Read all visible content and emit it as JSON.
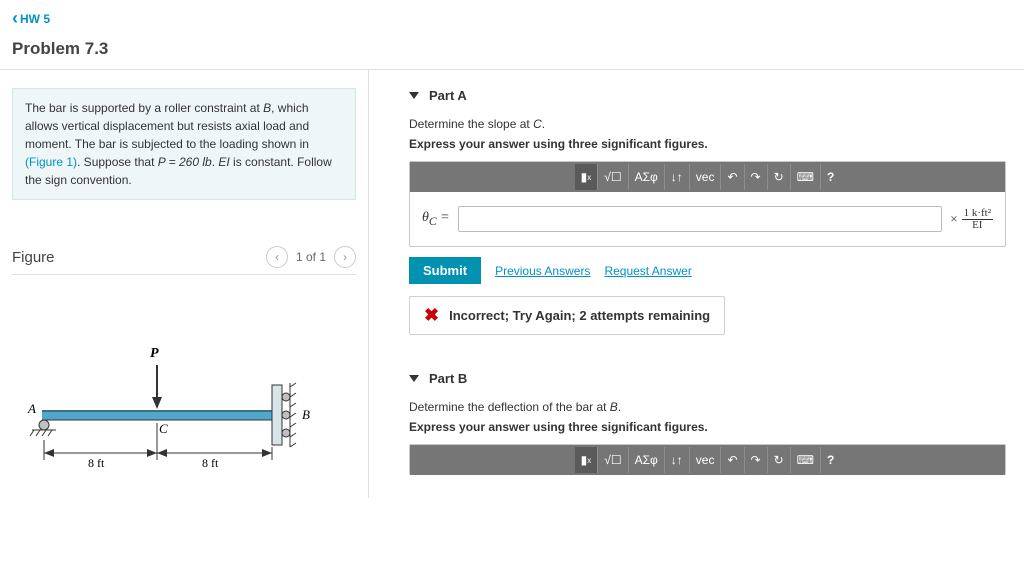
{
  "nav": {
    "back": "HW 5"
  },
  "problem": {
    "title": "Problem 7.3",
    "desc_1": "The bar is supported by a roller constraint at ",
    "desc_B": "B",
    "desc_2": ", which allows vertical displacement but resists axial load and moment. The bar is subjected to the loading shown in ",
    "fig_link": "(Figure 1)",
    "desc_3": ". Suppose that ",
    "P_eq": "P = 260 lb",
    "desc_4": ". ",
    "EI": "EI",
    "desc_5": " is constant. Follow the sign convention."
  },
  "figure": {
    "label": "Figure",
    "pager": "1 of 1",
    "P": "P",
    "A": "A",
    "B": "B",
    "C": "C",
    "d1": "8 ft",
    "d2": "8 ft"
  },
  "partA": {
    "title": "Part A",
    "line1a": "Determine the slope at ",
    "line1b": "C",
    "line1c": ".",
    "line2": "Express your answer using three significant figures.",
    "symbol": "θ",
    "sub": "C",
    "eq": " = ",
    "times": "×",
    "unit_top": "1 k·ft²",
    "unit_bot": "EI",
    "submit": "Submit",
    "prev": "Previous Answers",
    "req": "Request Answer",
    "feedback": "Incorrect; Try Again; 2 attempts remaining"
  },
  "toolbar": {
    "t2": "ΑΣφ",
    "t4": "vec",
    "t9": "?"
  },
  "partB": {
    "title": "Part B",
    "line1a": "Determine the deflection of the bar at ",
    "line1b": "B",
    "line1c": ".",
    "line2": "Express your answer using three significant figures."
  }
}
